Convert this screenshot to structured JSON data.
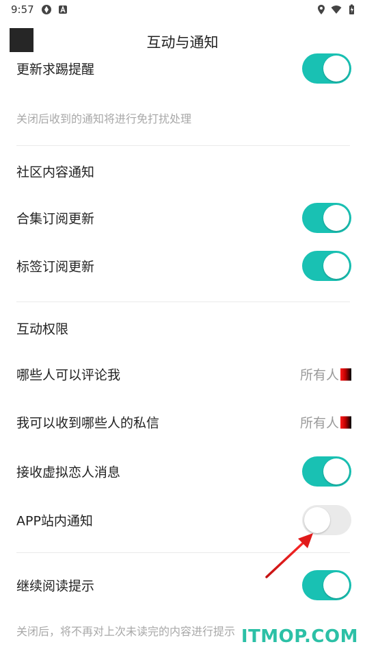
{
  "status_bar": {
    "time": "9:57"
  },
  "header": {
    "title": "互动与通知"
  },
  "items": {
    "update_reminder": {
      "label": "更新求踢提醒",
      "on": true
    },
    "dnd_hint": "关闭后收到的通知将进行免打扰处理",
    "community_section": "社区内容通知",
    "collection_update": {
      "label": "合集订阅更新",
      "on": true
    },
    "tag_update": {
      "label": "标签订阅更新",
      "on": true
    },
    "interaction_section": "互动权限",
    "who_comment": {
      "label": "哪些人可以评论我",
      "value": "所有人"
    },
    "who_message": {
      "label": "我可以收到哪些人的私信",
      "value": "所有人"
    },
    "virtual_lover": {
      "label": "接收虚拟恋人消息",
      "on": true
    },
    "app_notice": {
      "label": "APP站内通知",
      "on": false
    },
    "continue_reading": {
      "label": "继续阅读提示",
      "on": true
    },
    "reading_hint": "关闭后，将不再对上次未读完的内容进行提示"
  },
  "watermark": "ITMOP.COM",
  "colors": {
    "toggle_on": "#19c1b3",
    "toggle_off": "#eaeaea",
    "watermark": "#2cc0a6"
  }
}
